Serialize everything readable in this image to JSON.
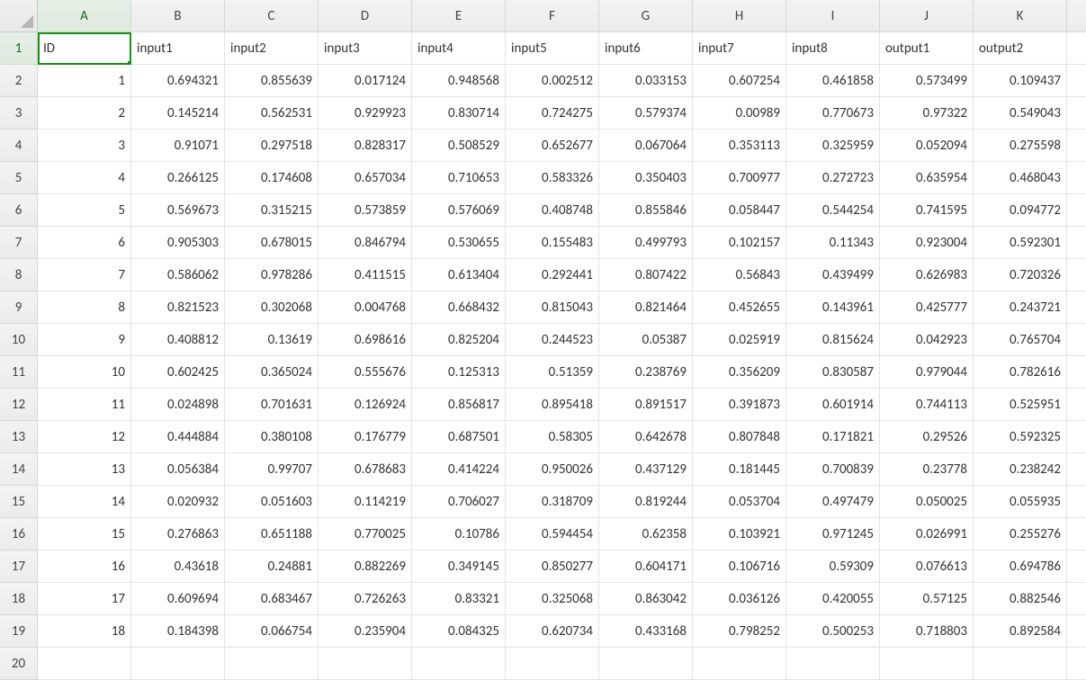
{
  "selected_cell": "A1",
  "selected_col_index": 0,
  "selected_row_index": 0,
  "columns": [
    "A",
    "B",
    "C",
    "D",
    "E",
    "F",
    "G",
    "H",
    "I",
    "J",
    "K"
  ],
  "row_numbers": [
    1,
    2,
    3,
    4,
    5,
    6,
    7,
    8,
    9,
    10,
    11,
    12,
    13,
    14,
    15,
    16,
    17,
    18,
    19,
    20
  ],
  "headers": [
    "ID",
    "input1",
    "input2",
    "input3",
    "input4",
    "input5",
    "input6",
    "input7",
    "input8",
    "output1",
    "output2"
  ],
  "rows": [
    [
      "1",
      "0.694321",
      "0.855639",
      "0.017124",
      "0.948568",
      "0.002512",
      "0.033153",
      "0.607254",
      "0.461858",
      "0.573499",
      "0.109437"
    ],
    [
      "2",
      "0.145214",
      "0.562531",
      "0.929923",
      "0.830714",
      "0.724275",
      "0.579374",
      "0.00989",
      "0.770673",
      "0.97322",
      "0.549043"
    ],
    [
      "3",
      "0.91071",
      "0.297518",
      "0.828317",
      "0.508529",
      "0.652677",
      "0.067064",
      "0.353113",
      "0.325959",
      "0.052094",
      "0.275598"
    ],
    [
      "4",
      "0.266125",
      "0.174608",
      "0.657034",
      "0.710653",
      "0.583326",
      "0.350403",
      "0.700977",
      "0.272723",
      "0.635954",
      "0.468043"
    ],
    [
      "5",
      "0.569673",
      "0.315215",
      "0.573859",
      "0.576069",
      "0.408748",
      "0.855846",
      "0.058447",
      "0.544254",
      "0.741595",
      "0.094772"
    ],
    [
      "6",
      "0.905303",
      "0.678015",
      "0.846794",
      "0.530655",
      "0.155483",
      "0.499793",
      "0.102157",
      "0.11343",
      "0.923004",
      "0.592301"
    ],
    [
      "7",
      "0.586062",
      "0.978286",
      "0.411515",
      "0.613404",
      "0.292441",
      "0.807422",
      "0.56843",
      "0.439499",
      "0.626983",
      "0.720326"
    ],
    [
      "8",
      "0.821523",
      "0.302068",
      "0.004768",
      "0.668432",
      "0.815043",
      "0.821464",
      "0.452655",
      "0.143961",
      "0.425777",
      "0.243721"
    ],
    [
      "9",
      "0.408812",
      "0.13619",
      "0.698616",
      "0.825204",
      "0.244523",
      "0.05387",
      "0.025919",
      "0.815624",
      "0.042923",
      "0.765704"
    ],
    [
      "10",
      "0.602425",
      "0.365024",
      "0.555676",
      "0.125313",
      "0.51359",
      "0.238769",
      "0.356209",
      "0.830587",
      "0.979044",
      "0.782616"
    ],
    [
      "11",
      "0.024898",
      "0.701631",
      "0.126924",
      "0.856817",
      "0.895418",
      "0.891517",
      "0.391873",
      "0.601914",
      "0.744113",
      "0.525951"
    ],
    [
      "12",
      "0.444884",
      "0.380108",
      "0.176779",
      "0.687501",
      "0.58305",
      "0.642678",
      "0.807848",
      "0.171821",
      "0.29526",
      "0.592325"
    ],
    [
      "13",
      "0.056384",
      "0.99707",
      "0.678683",
      "0.414224",
      "0.950026",
      "0.437129",
      "0.181445",
      "0.700839",
      "0.23778",
      "0.238242"
    ],
    [
      "14",
      "0.020932",
      "0.051603",
      "0.114219",
      "0.706027",
      "0.318709",
      "0.819244",
      "0.053704",
      "0.497479",
      "0.050025",
      "0.055935"
    ],
    [
      "15",
      "0.276863",
      "0.651188",
      "0.770025",
      "0.10786",
      "0.594454",
      "0.62358",
      "0.103921",
      "0.971245",
      "0.026991",
      "0.255276"
    ],
    [
      "16",
      "0.43618",
      "0.24881",
      "0.882269",
      "0.349145",
      "0.850277",
      "0.604171",
      "0.106716",
      "0.59309",
      "0.076613",
      "0.694786"
    ],
    [
      "17",
      "0.609694",
      "0.683467",
      "0.726263",
      "0.83321",
      "0.325068",
      "0.863042",
      "0.036126",
      "0.420055",
      "0.57125",
      "0.882546"
    ],
    [
      "18",
      "0.184398",
      "0.066754",
      "0.235904",
      "0.084325",
      "0.620734",
      "0.433168",
      "0.798252",
      "0.500253",
      "0.718803",
      "0.892584"
    ]
  ]
}
